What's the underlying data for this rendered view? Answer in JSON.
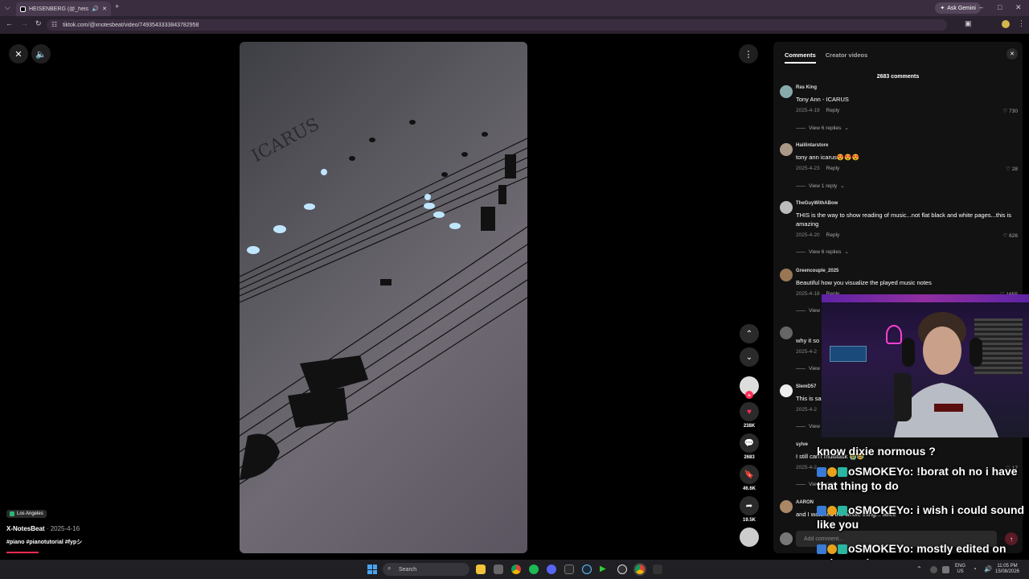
{
  "browser": {
    "tab_title": "HEISENBERG (@_heisenb",
    "url": "tiktok.com/@xnotesbeat/video/7493543333843782958",
    "gemini_label": "Ask Gemini"
  },
  "video": {
    "location": "Los Angeles",
    "author": "X-NotesBeat",
    "date": "2025-4-16",
    "tags": "#piano #pianotutorial #fypシ"
  },
  "rail": {
    "likes": "238K",
    "comments": "2683",
    "saves": "46.6K",
    "shares": "19.5K"
  },
  "panel": {
    "tab_comments": "Comments",
    "tab_creator": "Creator videos",
    "comment_count": "2683 comments",
    "add_placeholder": "Add comment...",
    "comments": [
      {
        "name": "Ras King",
        "text": "Tony Ann - ICARUS",
        "date": "2025-4-19",
        "reply": "Reply",
        "likes": "730",
        "replies": "View 6 replies"
      },
      {
        "name": "Haiilintarstore",
        "text": "tony ann icarus😍😍😍",
        "date": "2025-4-23",
        "reply": "Reply",
        "likes": "28",
        "replies": "View 1 reply"
      },
      {
        "name": "TheGuyWithABow",
        "text": "THIS is the way to show reading of music...not flat black and white pages...this is amazing",
        "date": "2025-4-20",
        "reply": "Reply",
        "likes": "626",
        "replies": "View 6 replies"
      },
      {
        "name": "Greencouple_2025",
        "text": "Beautiful how you visualize the played music notes",
        "date": "2025-4-18",
        "reply": "Reply",
        "likes": "1655",
        "replies": "View"
      },
      {
        "name": "",
        "text": "why it so",
        "date": "2025-4-2",
        "reply": "",
        "likes": "",
        "replies": "View"
      },
      {
        "name": "SlemD57",
        "text": "This is sa",
        "date": "2025-4-2",
        "reply": "",
        "likes": "",
        "replies": "View"
      },
      {
        "name": "sylve",
        "text": "I still can't multitask 😭😂",
        "date": "2025-4-2",
        "reply": "",
        "likes": "17",
        "replies": "View 1 reply"
      },
      {
        "name": "AARON",
        "text": "and I watched the whole thing... twice",
        "date": "",
        "reply": "",
        "likes": "",
        "replies": ""
      }
    ]
  },
  "chat": {
    "line0": "know dixie normous ?",
    "line1_user": "oSMOKEYo:",
    "line1_msg": " !borat oh no i have that thing to do",
    "line2_user": "oSMOKEYo:",
    "line2_msg": " i wish i could sound like you",
    "line3_user": "oSMOKEYo:",
    "line3_msg": " mostly edited on voicemod"
  },
  "taskbar": {
    "search": "Search",
    "lang1": "ENG",
    "lang2": "US",
    "time": "11:05 PM",
    "date": "15/08/2026"
  }
}
